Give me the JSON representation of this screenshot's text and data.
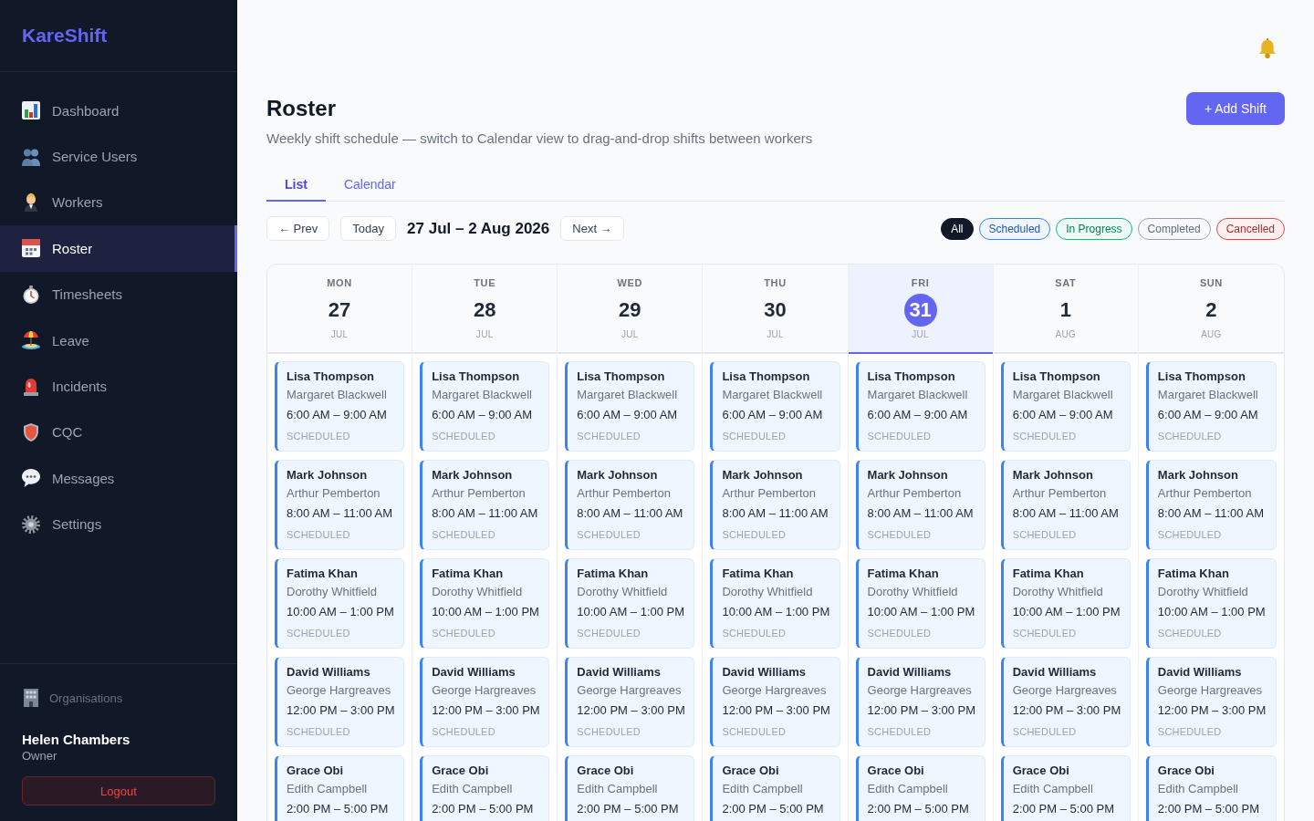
{
  "sidebar": {
    "logo": "KareShift",
    "nav": [
      {
        "label": "Dashboard",
        "selected": false
      },
      {
        "label": "Service Users",
        "selected": false
      },
      {
        "label": "Workers",
        "selected": false
      },
      {
        "label": "Roster",
        "selected": true
      },
      {
        "label": "Timesheets",
        "selected": false
      },
      {
        "label": "Leave",
        "selected": false
      },
      {
        "label": "Incidents",
        "selected": false
      },
      {
        "label": "CQC",
        "selected": false
      },
      {
        "label": "Messages",
        "selected": false
      },
      {
        "label": "Settings",
        "selected": false
      }
    ],
    "organisations": "Organisations",
    "user": {
      "name": "Helen Chambers",
      "role": "Owner"
    },
    "logout": "Logout"
  },
  "header": {
    "title": "Roster",
    "subtitle": "Weekly shift schedule — switch to Calendar view to drag-and-drop shifts between workers",
    "add_button": "+ Add Shift"
  },
  "tabs": [
    {
      "label": "List",
      "selected": true
    },
    {
      "label": "Calendar",
      "selected": false
    }
  ],
  "toolbar": {
    "prev": "← Prev",
    "today": "Today",
    "range": "27 Jul – 2 Aug 2026",
    "next": "Next →"
  },
  "filters": [
    {
      "label": "All",
      "selected": true,
      "color": "#111827"
    },
    {
      "label": "Scheduled",
      "selected": false,
      "color": "#3b82f6"
    },
    {
      "label": "In Progress",
      "selected": false,
      "color": "#10b981"
    },
    {
      "label": "Completed",
      "selected": false,
      "color": "#94a3b8"
    },
    {
      "label": "Cancelled",
      "selected": false,
      "color": "#ef4444"
    }
  ],
  "week": {
    "days": [
      {
        "weekday": "MON",
        "day": "27",
        "month": "JUL",
        "today": false,
        "shifts": [
          {
            "worker": "Lisa Thompson",
            "client": "Margaret Blackwell",
            "time": "6:00 AM – 9:00 AM",
            "status": "SCHEDULED"
          },
          {
            "worker": "Mark Johnson",
            "client": "Arthur Pemberton",
            "time": "8:00 AM – 11:00 AM",
            "status": "SCHEDULED"
          },
          {
            "worker": "Fatima Khan",
            "client": "Dorothy Whitfield",
            "time": "10:00 AM – 1:00 PM",
            "status": "SCHEDULED"
          },
          {
            "worker": "David Williams",
            "client": "George Hargreaves",
            "time": "12:00 PM – 3:00 PM",
            "status": "SCHEDULED"
          },
          {
            "worker": "Grace Obi",
            "client": "Edith Campbell",
            "time": "2:00 PM – 5:00 PM"
          }
        ]
      },
      {
        "weekday": "TUE",
        "day": "28",
        "month": "JUL",
        "today": false,
        "shifts": [
          {
            "worker": "Lisa Thompson",
            "client": "Margaret Blackwell",
            "time": "6:00 AM – 9:00 AM",
            "status": "SCHEDULED"
          },
          {
            "worker": "Mark Johnson",
            "client": "Arthur Pemberton",
            "time": "8:00 AM – 11:00 AM",
            "status": "SCHEDULED"
          },
          {
            "worker": "Fatima Khan",
            "client": "Dorothy Whitfield",
            "time": "10:00 AM – 1:00 PM",
            "status": "SCHEDULED"
          },
          {
            "worker": "David Williams",
            "client": "George Hargreaves",
            "time": "12:00 PM – 3:00 PM",
            "status": "SCHEDULED"
          },
          {
            "worker": "Grace Obi",
            "client": "Edith Campbell",
            "time": "2:00 PM – 5:00 PM"
          }
        ]
      },
      {
        "weekday": "WED",
        "day": "29",
        "month": "JUL",
        "today": false,
        "shifts": [
          {
            "worker": "Lisa Thompson",
            "client": "Margaret Blackwell",
            "time": "6:00 AM – 9:00 AM",
            "status": "SCHEDULED"
          },
          {
            "worker": "Mark Johnson",
            "client": "Arthur Pemberton",
            "time": "8:00 AM – 11:00 AM",
            "status": "SCHEDULED"
          },
          {
            "worker": "Fatima Khan",
            "client": "Dorothy Whitfield",
            "time": "10:00 AM – 1:00 PM",
            "status": "SCHEDULED"
          },
          {
            "worker": "David Williams",
            "client": "George Hargreaves",
            "time": "12:00 PM – 3:00 PM",
            "status": "SCHEDULED"
          },
          {
            "worker": "Grace Obi",
            "client": "Edith Campbell",
            "time": "2:00 PM – 5:00 PM"
          }
        ]
      },
      {
        "weekday": "THU",
        "day": "30",
        "month": "JUL",
        "today": false,
        "shifts": [
          {
            "worker": "Lisa Thompson",
            "client": "Margaret Blackwell",
            "time": "6:00 AM – 9:00 AM",
            "status": "SCHEDULED"
          },
          {
            "worker": "Mark Johnson",
            "client": "Arthur Pemberton",
            "time": "8:00 AM – 11:00 AM",
            "status": "SCHEDULED"
          },
          {
            "worker": "Fatima Khan",
            "client": "Dorothy Whitfield",
            "time": "10:00 AM – 1:00 PM",
            "status": "SCHEDULED"
          },
          {
            "worker": "David Williams",
            "client": "George Hargreaves",
            "time": "12:00 PM – 3:00 PM",
            "status": "SCHEDULED"
          },
          {
            "worker": "Grace Obi",
            "client": "Edith Campbell",
            "time": "2:00 PM – 5:00 PM"
          }
        ]
      },
      {
        "weekday": "FRI",
        "day": "31",
        "month": "JUL",
        "today": true,
        "shifts": [
          {
            "worker": "Lisa Thompson",
            "client": "Margaret Blackwell",
            "time": "6:00 AM – 9:00 AM",
            "status": "SCHEDULED"
          },
          {
            "worker": "Mark Johnson",
            "client": "Arthur Pemberton",
            "time": "8:00 AM – 11:00 AM",
            "status": "SCHEDULED"
          },
          {
            "worker": "Fatima Khan",
            "client": "Dorothy Whitfield",
            "time": "10:00 AM – 1:00 PM",
            "status": "SCHEDULED"
          },
          {
            "worker": "David Williams",
            "client": "George Hargreaves",
            "time": "12:00 PM – 3:00 PM",
            "status": "SCHEDULED"
          },
          {
            "worker": "Grace Obi",
            "client": "Edith Campbell",
            "time": "2:00 PM – 5:00 PM"
          }
        ]
      },
      {
        "weekday": "SAT",
        "day": "1",
        "month": "AUG",
        "today": false,
        "shifts": [
          {
            "worker": "Lisa Thompson",
            "client": "Margaret Blackwell",
            "time": "6:00 AM – 9:00 AM",
            "status": "SCHEDULED"
          },
          {
            "worker": "Mark Johnson",
            "client": "Arthur Pemberton",
            "time": "8:00 AM – 11:00 AM",
            "status": "SCHEDULED"
          },
          {
            "worker": "Fatima Khan",
            "client": "Dorothy Whitfield",
            "time": "10:00 AM – 1:00 PM",
            "status": "SCHEDULED"
          },
          {
            "worker": "David Williams",
            "client": "George Hargreaves",
            "time": "12:00 PM – 3:00 PM",
            "status": "SCHEDULED"
          },
          {
            "worker": "Grace Obi",
            "client": "Edith Campbell",
            "time": "2:00 PM – 5:00 PM"
          }
        ]
      },
      {
        "weekday": "SUN",
        "day": "2",
        "month": "AUG",
        "today": false,
        "shifts": [
          {
            "worker": "Lisa Thompson",
            "client": "Margaret Blackwell",
            "time": "6:00 AM – 9:00 AM",
            "status": "SCHEDULED"
          },
          {
            "worker": "Mark Johnson",
            "client": "Arthur Pemberton",
            "time": "8:00 AM – 11:00 AM",
            "status": "SCHEDULED"
          },
          {
            "worker": "Fatima Khan",
            "client": "Dorothy Whitfield",
            "time": "10:00 AM – 1:00 PM",
            "status": "SCHEDULED"
          },
          {
            "worker": "David Williams",
            "client": "George Hargreaves",
            "time": "12:00 PM – 3:00 PM",
            "status": "SCHEDULED"
          },
          {
            "worker": "Grace Obi",
            "client": "Edith Campbell",
            "time": "2:00 PM – 5:00 PM"
          }
        ]
      }
    ]
  }
}
